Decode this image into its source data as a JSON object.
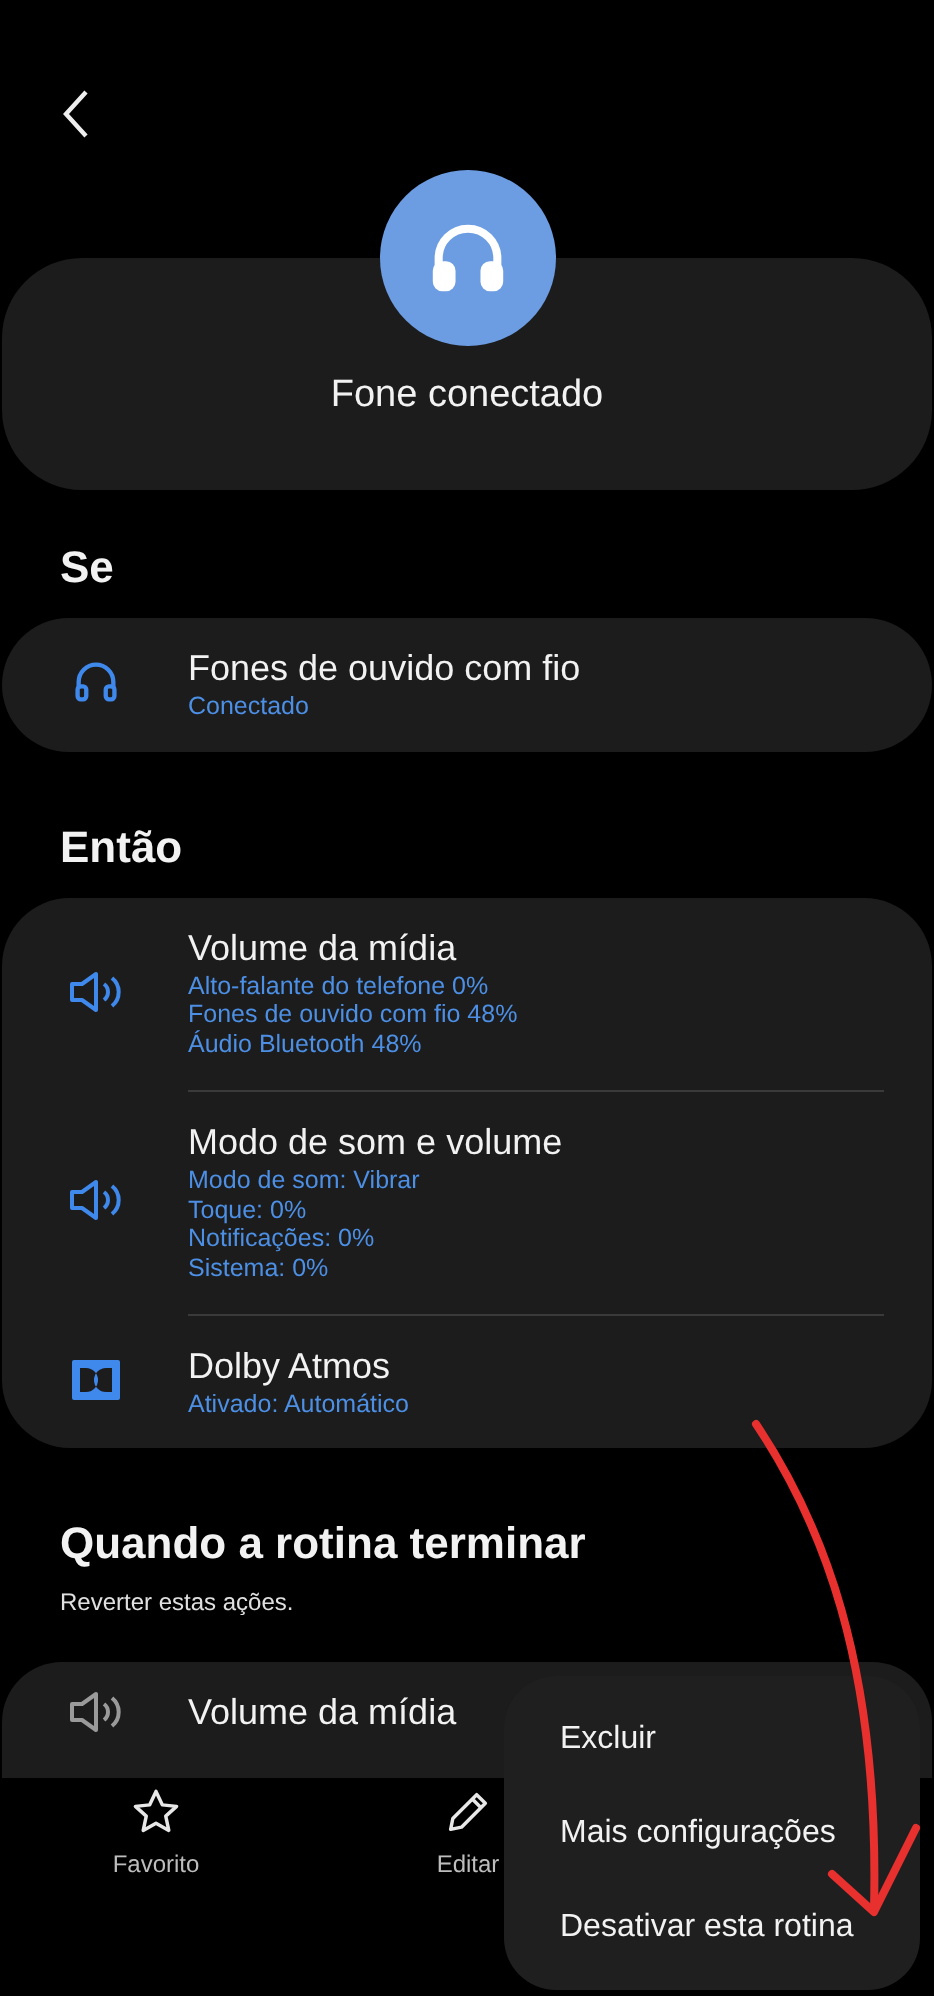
{
  "header": {
    "title": "Fone conectado"
  },
  "sections": [
    {
      "heading": "Se",
      "items": [
        {
          "kind": "headphones",
          "active": true,
          "title": "Fones de ouvido com fio",
          "details": [
            "Conectado"
          ]
        }
      ]
    },
    {
      "heading": "Então",
      "items": [
        {
          "kind": "volume",
          "active": true,
          "title": "Volume da mídia",
          "details": [
            "Alto-falante do telefone 0%",
            "Fones de ouvido com fio 48%",
            "Áudio Bluetooth 48%"
          ]
        },
        {
          "kind": "volume",
          "active": true,
          "title": "Modo de som e volume",
          "details": [
            "Modo de som: Vibrar",
            "Toque: 0%",
            "Notificações: 0%",
            "Sistema: 0%"
          ]
        },
        {
          "kind": "dolby",
          "active": true,
          "title": "Dolby Atmos",
          "details": [
            "Ativado: Automático"
          ]
        }
      ]
    },
    {
      "heading": "Quando a rotina terminar",
      "subtitle": "Reverter estas ações.",
      "items": [
        {
          "kind": "volume",
          "active": false,
          "title": "Volume da mídia"
        }
      ]
    }
  ],
  "bottom_nav": [
    {
      "kind": "star",
      "label": "Favorito"
    },
    {
      "kind": "pencil",
      "label": "Editar"
    }
  ],
  "menu": [
    "Excluir",
    "Mais configurações",
    "Desativar esta rotina"
  ]
}
